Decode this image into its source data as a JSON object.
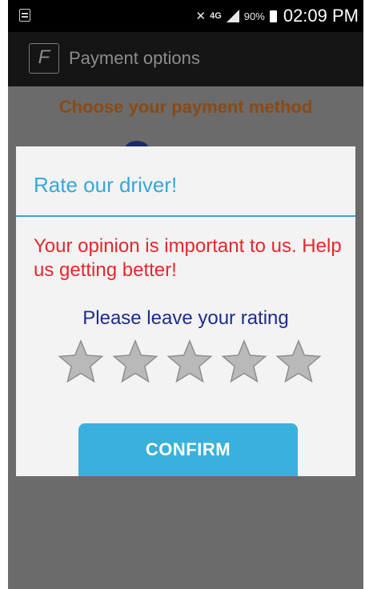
{
  "status_bar": {
    "net_type": "4G",
    "battery_percent": "90%",
    "time": "02:09 PM",
    "icons": [
      "notes-icon",
      "mute-icon",
      "signal-icon",
      "battery-icon"
    ]
  },
  "app_bar": {
    "logo_glyph": "F",
    "title": "Payment options"
  },
  "background": {
    "heading": "Choose your payment method"
  },
  "dialog": {
    "title": "Rate our driver!",
    "message": "Your opinion is important to us. Help us getting better!",
    "rating_prompt": "Please leave your rating",
    "rating": {
      "value": 0,
      "max": 5
    },
    "confirm_label": "CONFIRM"
  },
  "colors": {
    "accent": "#36a7d9",
    "message_red": "#e8262b",
    "prompt_blue": "#1d2b8f",
    "heading_brown": "#8a4a15",
    "star_gray": "#b9b9b9"
  }
}
